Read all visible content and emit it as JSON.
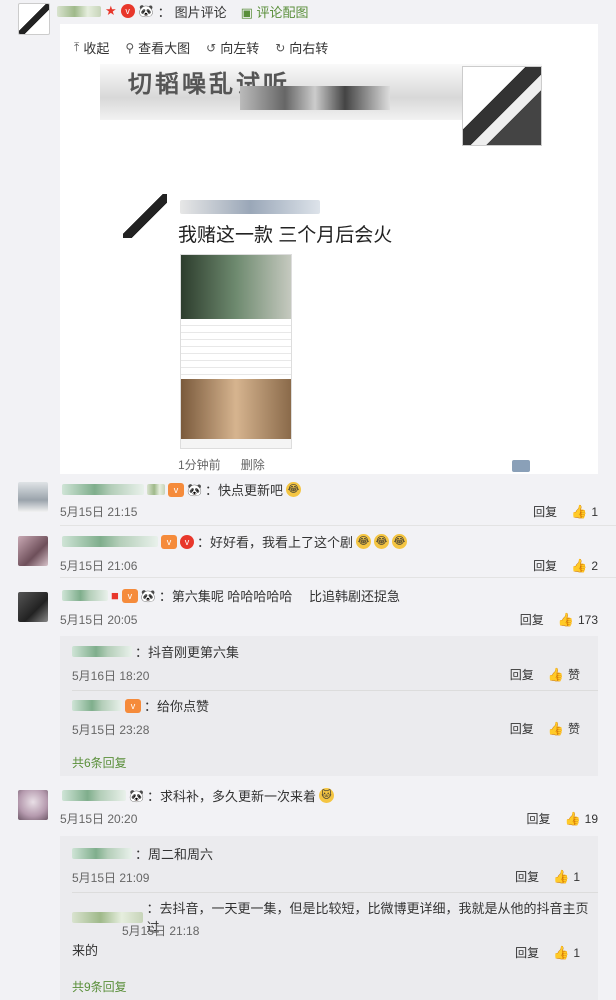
{
  "header": {
    "separator": "：",
    "pic_comment": "图片评论",
    "pic_link": "评论配图"
  },
  "image_viewer": {
    "toolbar": {
      "collapse": "收起",
      "view_large": "查看大图",
      "rotate_left": "向左转",
      "rotate_right": "向右转"
    },
    "banner_text": "切韬噪乱试听",
    "inner_post_text": "我赌这一款 三个月后会火",
    "inner_time": "1分钟前",
    "inner_delete": "删除"
  },
  "actions": {
    "reply": "回复",
    "like_label": "赞"
  },
  "comments": [
    {
      "text": "：快点更新吧",
      "time": "5月15日 21:15",
      "likes": "1"
    },
    {
      "text": "：好好看，我看上了这个剧",
      "time": "5月15日 21:06",
      "likes": "2"
    },
    {
      "text": "：第六集呢 哈哈哈哈哈 　比追韩剧还捉急",
      "time": "5月15日 20:05",
      "likes": "173",
      "replies": [
        {
          "text": "：抖音刚更第六集",
          "time": "5月16日 18:20",
          "likes": "赞"
        },
        {
          "text": "：给你点赞",
          "time": "5月15日 23:28",
          "likes": "赞"
        }
      ],
      "more": "共6条回复"
    },
    {
      "text": "：求科补，多久更新一次来着",
      "time": "5月15日 20:20",
      "likes": "19",
      "replies": [
        {
          "text": "：周二和周六",
          "time": "5月15日 21:09",
          "likes": "1"
        },
        {
          "text": "：去抖音，一天更一集，但是比较短，比微博更详细，我就是从他的抖音主页过",
          "text2": "来的",
          "time": "5月15日 21:18",
          "likes": "1"
        }
      ],
      "more": "共9条回复"
    }
  ]
}
